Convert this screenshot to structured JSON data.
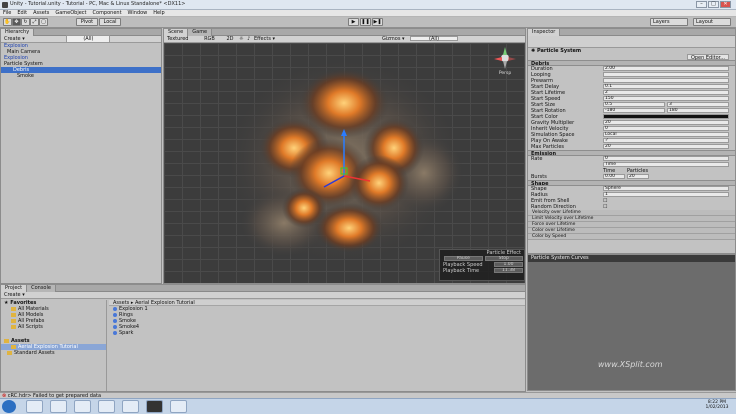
{
  "window": {
    "title": "Unity - Tutorial.unity - Tutorial - PC, Mac & Linux Standalone* <DX11>",
    "min": "–",
    "max": "□",
    "close": "✕"
  },
  "menu": [
    "File",
    "Edit",
    "Assets",
    "GameObject",
    "Component",
    "Window",
    "Help"
  ],
  "toolbar": {
    "pivot": "Pivot",
    "local": "Local",
    "layers": "Layers",
    "layout": "Layout"
  },
  "hierarchy": {
    "tab": "Hierarchy",
    "create": "Create ▾",
    "search": "(All)",
    "items": [
      "Explosion",
      "Main Camera",
      "Explosion",
      "Particle System",
      "Debris",
      "Smoke"
    ]
  },
  "scene": {
    "tab_scene": "Scene",
    "tab_game": "Game",
    "textured": "Textured",
    "rgb": "RGB",
    "mode2d": "2D",
    "effects": "Effects ▾",
    "gizmos": "Gizmos ▾",
    "search": "(All)",
    "persp": "Persp"
  },
  "particle_overlay": {
    "title": "Particle Effect",
    "pause": "Pause",
    "stop": "Stop",
    "speed_label": "Playback Speed",
    "speed": "1.00",
    "time_label": "Playback Time",
    "time": "11.38"
  },
  "inspector": {
    "tab": "Inspector",
    "component": "Particle System",
    "open_editor": "Open Editor...",
    "module": "Debris",
    "props": [
      {
        "label": "Duration",
        "value": "2.00"
      },
      {
        "label": "Looping",
        "value": ""
      },
      {
        "label": "Prewarm",
        "value": ""
      },
      {
        "label": "Start Delay",
        "value": "0.1"
      },
      {
        "label": "Start Lifetime",
        "value": "2"
      },
      {
        "label": "Start Speed",
        "value": "150"
      },
      {
        "label": "Start Size",
        "value": "0.5"
      },
      {
        "label": "Start Rotation",
        "value": "-180"
      },
      {
        "label": "Start Color",
        "value": ""
      },
      {
        "label": "Gravity Multiplier",
        "value": "20"
      },
      {
        "label": "Inherit Velocity",
        "value": "0"
      },
      {
        "label": "Simulation Space",
        "value": "Local"
      },
      {
        "label": "Play On Awake",
        "value": "✓"
      },
      {
        "label": "Max Particles",
        "value": "20"
      }
    ],
    "size_max": "3",
    "rot_max": "180",
    "emission": "Emission",
    "rate_label": "Rate",
    "rate": "0",
    "time_mode": "Time",
    "bursts_label": "Bursts",
    "burst_time_h": "Time",
    "burst_part_h": "Particles",
    "burst_time": "0.00",
    "burst_part": "20",
    "shape": "Shape",
    "shape_label": "Shape",
    "shape_val": "Sphere",
    "radius_label": "Radius",
    "radius": "1",
    "emit_shell": "Emit from Shell",
    "random_dir": "Random Direction",
    "modules": [
      "Velocity over Lifetime",
      "Limit Velocity over Lifetime",
      "Force over Lifetime",
      "Color over Lifetime",
      "Color by Speed"
    ],
    "curves": "Particle System Curves"
  },
  "project": {
    "tab_project": "Project",
    "tab_console": "Console",
    "create": "Create ▾",
    "favorites": "Favorites",
    "fav_items": [
      "All Materials",
      "All Models",
      "All Prefabs",
      "All Scripts"
    ],
    "assets": "Assets",
    "asset_folders": [
      "Aerial Explosion Tutorial",
      "Standard Assets"
    ],
    "breadcrumb": "Assets ▸ Aerial Explosion Tutorial",
    "files": [
      "Explosion 1",
      "Rings",
      "Smoke",
      "Smoke4",
      "Spark"
    ]
  },
  "status": {
    "error": "cRC.hdr> Failed to get prepared data"
  },
  "watermark": "www.XSplit.com",
  "clock": {
    "time": "8:22 PM",
    "date": "1/02/2013"
  }
}
